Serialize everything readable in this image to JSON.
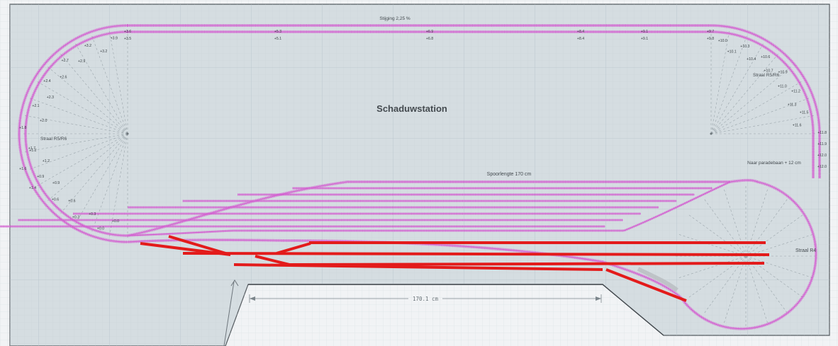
{
  "diagram": {
    "title": "Schaduwstation",
    "grade_label": "Stijging 2,25 %",
    "siding_length_label": "Spoorlengte 170 cm",
    "exit_label": "Naar paradebaan + 12 cm",
    "radius_left_label": "Straal R5/R6",
    "radius_right_label": "Straal R5/R6",
    "radius_loop_label": "Straal R4",
    "dimension_label": "170.1 cm",
    "colors": {
      "board": "#d5dde1",
      "grid": "#bcc9cf",
      "track": "#d35fd0",
      "red_track": "#e31b1b",
      "frame": "#555b60"
    },
    "elev_outer": [
      "+3.6",
      "+5.3",
      "+6.9",
      "+8.4",
      "+9.1",
      "+9.7"
    ],
    "elev_inner": [
      "+3.5",
      "+5.1",
      "+6.8",
      "+8.4",
      "+9.1",
      "+9.8"
    ],
    "elev_left_upper": [
      "+3.9",
      "+3.2",
      "+3.2",
      "+2.9",
      "+2.7",
      "+2.6",
      "+2.4",
      "+2.3",
      "+2.1",
      "+2.0"
    ],
    "elev_left_mid": [
      "+1.8",
      "+1.7",
      "+1.6",
      "+1.4"
    ],
    "elev_left_lower": [
      "+1.2",
      "+1.2",
      "+0.9",
      "+0.9",
      "+0.6",
      "+0.6",
      "+0.3",
      "+0.3",
      "+0.0",
      "+0.0"
    ],
    "elev_right": [
      "+10.0",
      "+10.1",
      "+10.3",
      "+10.4",
      "+10.6",
      "+10.7",
      "+10.9",
      "+11.0",
      "+11.2",
      "+11.3",
      "+11.5",
      "+11.6",
      "+11.8",
      "+11.9",
      "+12.0",
      "+12.0"
    ]
  }
}
